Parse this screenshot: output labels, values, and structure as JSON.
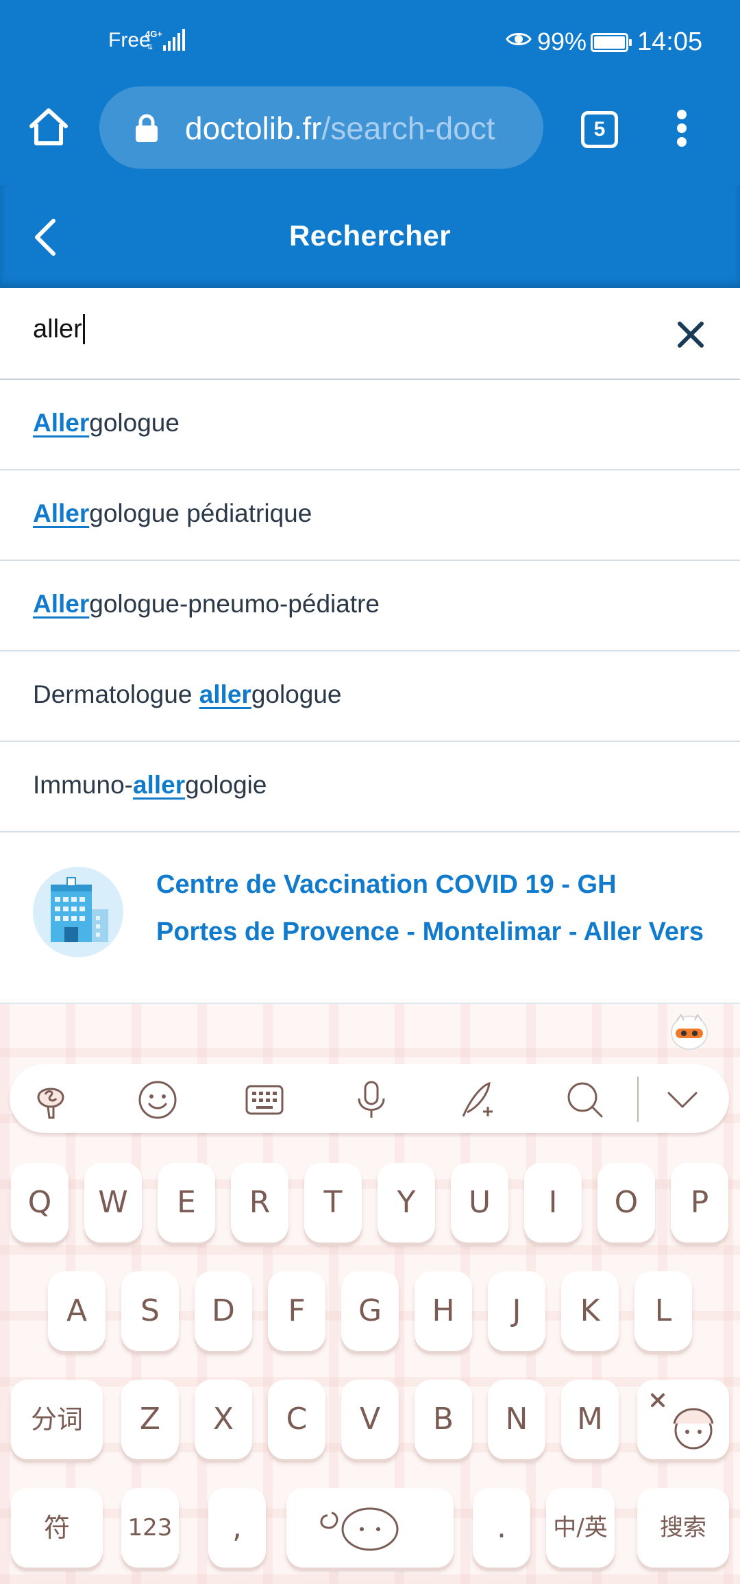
{
  "status_bar": {
    "carrier": "Free",
    "network": "4G+",
    "battery_percent": "99%",
    "time": "14:05",
    "icons": [
      "signal-icon",
      "eye-icon",
      "battery-icon"
    ]
  },
  "browser": {
    "url_domain": "doctolib.fr",
    "url_path": "/search-doct",
    "tab_count": "5",
    "icons": [
      "home-icon",
      "lock-icon",
      "tabs-icon",
      "more-vert-icon"
    ]
  },
  "header": {
    "title": "Rechercher",
    "back_icon": "chevron-left-icon"
  },
  "search": {
    "value": "aller",
    "clear_icon": "close-icon"
  },
  "suggestions": [
    {
      "before": "",
      "match": "Aller",
      "after": "gologue"
    },
    {
      "before": "",
      "match": "Aller",
      "after": "gologue pédiatrique"
    },
    {
      "before": "",
      "match": "Aller",
      "after": "gologue-pneumo-pédiatre"
    },
    {
      "before": "Dermatologue ",
      "match": "aller",
      "after": "gologue"
    },
    {
      "before": "Immuno-",
      "match": "aller",
      "after": "gologie"
    }
  ],
  "center_result": {
    "name": "Centre de Vaccination COVID 19 - GH Portes de Provence - Montelimar - Aller Vers",
    "icon": "hospital-building-icon"
  },
  "keyboard": {
    "toolbar_icons": [
      "skin-icon",
      "emoji-icon",
      "keyboard-icon",
      "microphone-icon",
      "handwriting-icon",
      "search-icon",
      "collapse-icon"
    ],
    "row1": [
      "Q",
      "W",
      "E",
      "R",
      "T",
      "Y",
      "U",
      "I",
      "O",
      "P"
    ],
    "row2": [
      "A",
      "S",
      "D",
      "F",
      "G",
      "H",
      "J",
      "K",
      "L"
    ],
    "row3": [
      "分词",
      "Z",
      "X",
      "C",
      "V",
      "B",
      "N",
      "M"
    ],
    "row4": [
      "符",
      "123",
      ",",
      "",
      ".",
      "中/英",
      "搜索"
    ],
    "colors": {
      "key_text": "#7a5c55",
      "background": "#fdf6f4"
    }
  },
  "colors": {
    "brand_blue": "#107acc",
    "text_dark": "#2a3848"
  }
}
